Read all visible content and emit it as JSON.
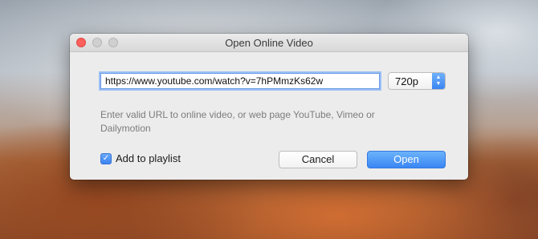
{
  "dialog": {
    "title": "Open Online Video",
    "url_value": "https://www.youtube.com/watch?v=7hPMmzKs62w",
    "quality": {
      "selected": "720p",
      "arrows_icon": "up-down-chevron-icon"
    },
    "hint": "Enter valid URL to online video, or web page YouTube, Vimeo or Dailymotion",
    "playlist_checkbox": {
      "label": "Add to playlist",
      "checked": true,
      "check_glyph": "✓"
    },
    "buttons": {
      "cancel": "Cancel",
      "open": "Open"
    }
  },
  "colors": {
    "accent": "#3a86f4",
    "close_button": "#fc605c"
  }
}
